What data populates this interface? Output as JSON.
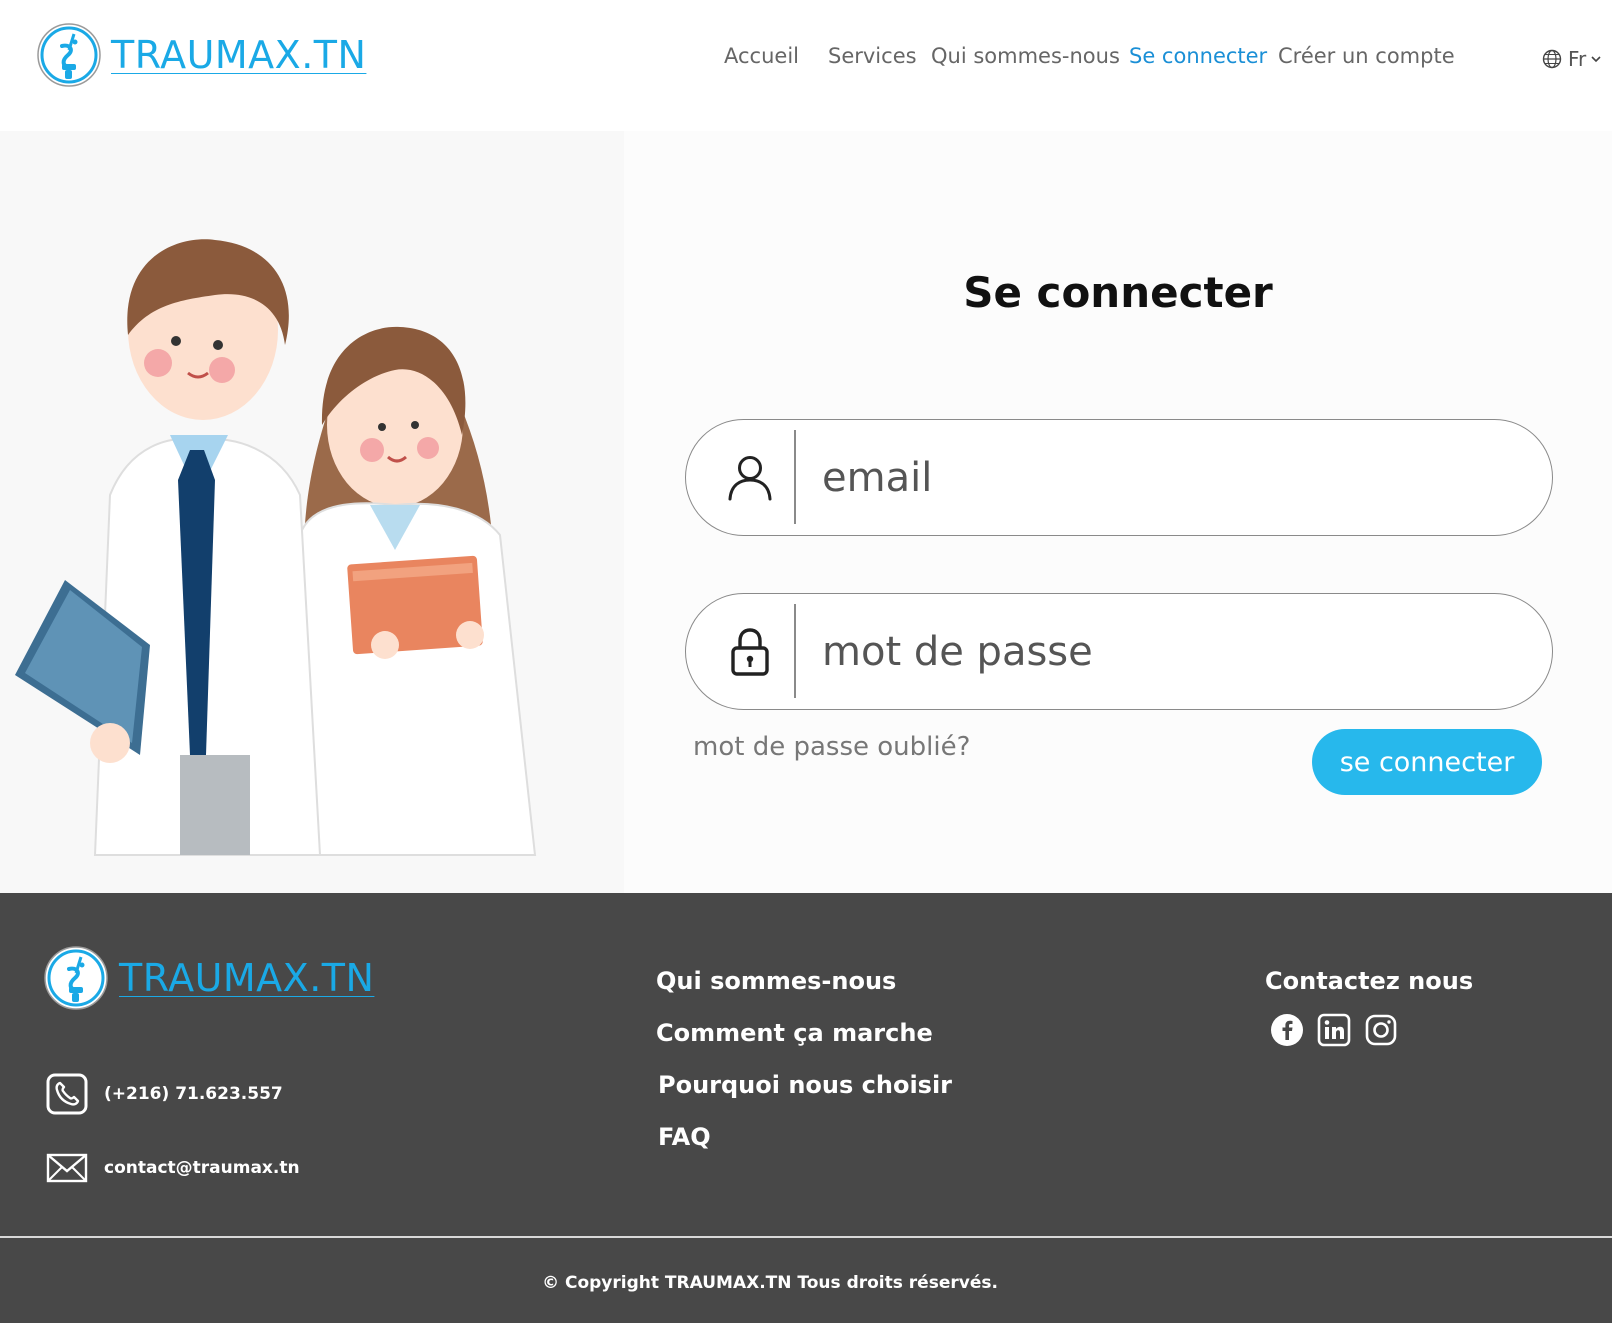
{
  "header": {
    "brand": "TRAUMAX.TN",
    "nav": [
      {
        "label": "Accueil",
        "active": false
      },
      {
        "label": "Services",
        "active": false
      },
      {
        "label": "Qui sommes-nous",
        "active": false
      },
      {
        "label": "Se connecter",
        "active": true
      },
      {
        "label": "Créer un compte",
        "active": false
      }
    ],
    "language": "Fr"
  },
  "login": {
    "title": "Se connecter",
    "email_placeholder": "email",
    "password_placeholder": "mot de passe",
    "forgot_label": "mot de passe oublié?",
    "submit_label": "se connecter"
  },
  "footer": {
    "brand": "TRAUMAX.TN",
    "phone": "(+216) 71.623.557",
    "email": "contact@traumax.tn",
    "links": [
      "Qui sommes-nous",
      "Comment ça marche",
      "Pourquoi nous choisir",
      "FAQ"
    ],
    "contact_title": "Contactez nous",
    "socials": [
      "facebook-icon",
      "linkedin-icon",
      "instagram-icon"
    ],
    "copyright": "© Copyright TRAUMAX.TN Tous droits réservés."
  },
  "colors": {
    "brand": "#1aa9e6",
    "active_nav": "#1a8fd6",
    "button": "#27b8ec",
    "footer_bg": "#484848"
  }
}
